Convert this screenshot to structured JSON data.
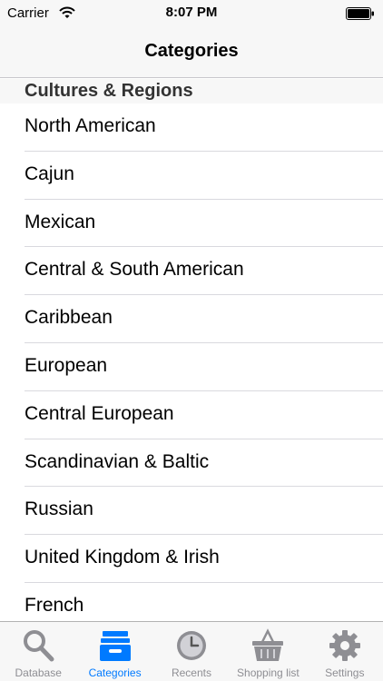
{
  "status_bar": {
    "carrier": "Carrier",
    "time": "8:07 PM"
  },
  "nav": {
    "title": "Categories"
  },
  "section": {
    "header": "Cultures & Regions"
  },
  "list_items": [
    "North American",
    "Cajun",
    "Mexican",
    "Central & South American",
    "Caribbean",
    "European",
    "Central European",
    "Scandinavian & Baltic",
    "Russian",
    "United Kingdom & Irish",
    "French"
  ],
  "tabs": [
    {
      "label": "Database",
      "icon": "magnifier-icon"
    },
    {
      "label": "Categories",
      "icon": "drawer-icon"
    },
    {
      "label": "Recents",
      "icon": "clock-icon"
    },
    {
      "label": "Shopping list",
      "icon": "basket-icon"
    },
    {
      "label": "Settings",
      "icon": "gear-icon"
    }
  ],
  "active_tab": "Categories",
  "colors": {
    "accent": "#007aff",
    "inactive": "#8e8e93",
    "bar": "#f7f7f7"
  }
}
